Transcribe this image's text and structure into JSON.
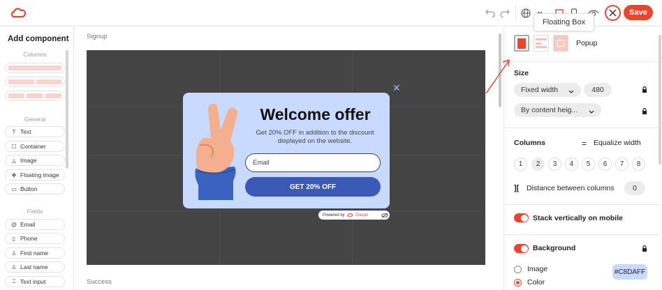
{
  "toolbar": {
    "save_label": "Save",
    "icons": [
      "undo-icon",
      "redo-icon",
      "globe-icon",
      "desktop-icon",
      "mobile-icon",
      "eye-icon",
      "close-icon"
    ]
  },
  "tooltip": {
    "text": "Floating Box"
  },
  "sidebar": {
    "title": "Add component",
    "columns_heading": "Columns",
    "general_heading": "General",
    "general_items": [
      {
        "label": "Text",
        "icon": "text-icon"
      },
      {
        "label": "Container",
        "icon": "container-icon"
      },
      {
        "label": "Image",
        "icon": "image-icon"
      },
      {
        "label": "Floating image",
        "icon": "floating-image-icon"
      },
      {
        "label": "Button",
        "icon": "button-icon"
      }
    ],
    "fields_heading": "Fields",
    "field_items": [
      {
        "label": "Email",
        "icon": "at-icon"
      },
      {
        "label": "Phone",
        "icon": "phone-icon"
      },
      {
        "label": "First name",
        "icon": "person-icon"
      },
      {
        "label": "Last name",
        "icon": "person-icon"
      },
      {
        "label": "Text input",
        "icon": "text-input-icon"
      }
    ]
  },
  "canvas": {
    "signup_label": "Signup",
    "success_label": "Success",
    "popup": {
      "title": "Welcome offer",
      "subtitle": "Get 20% OFF in addition to the discount displayed on the website.",
      "email_placeholder": "Email",
      "button_label": "GET 20% OFF",
      "background": "#C8DAFF",
      "button_color": "#3A59B6"
    },
    "powered_by": {
      "prefix": "Powered by",
      "brand": "Claspo"
    }
  },
  "panel": {
    "layout_label": "Popup",
    "size": {
      "heading": "Size",
      "width_mode": "Fixed width",
      "width_value": "480",
      "height_mode": "By content heig..."
    },
    "columns": {
      "heading": "Columns",
      "equalize_label": "Equalize width",
      "numbers": [
        "1",
        "2",
        "3",
        "4",
        "5",
        "6",
        "7",
        "8"
      ],
      "selected": "2",
      "distance_label": "Distance between columns",
      "distance_value": "0"
    },
    "stack_label": "Stack vertically on mobile",
    "stack_on": true,
    "background": {
      "heading": "Background",
      "enabled": true,
      "image_label": "Image",
      "color_label": "Color",
      "selected": "Color",
      "color_value": "#C8DAFF"
    }
  },
  "colors": {
    "accent": "#E8452C",
    "popup_bg": "#C8DAFF",
    "canvas_bg": "#444444"
  }
}
